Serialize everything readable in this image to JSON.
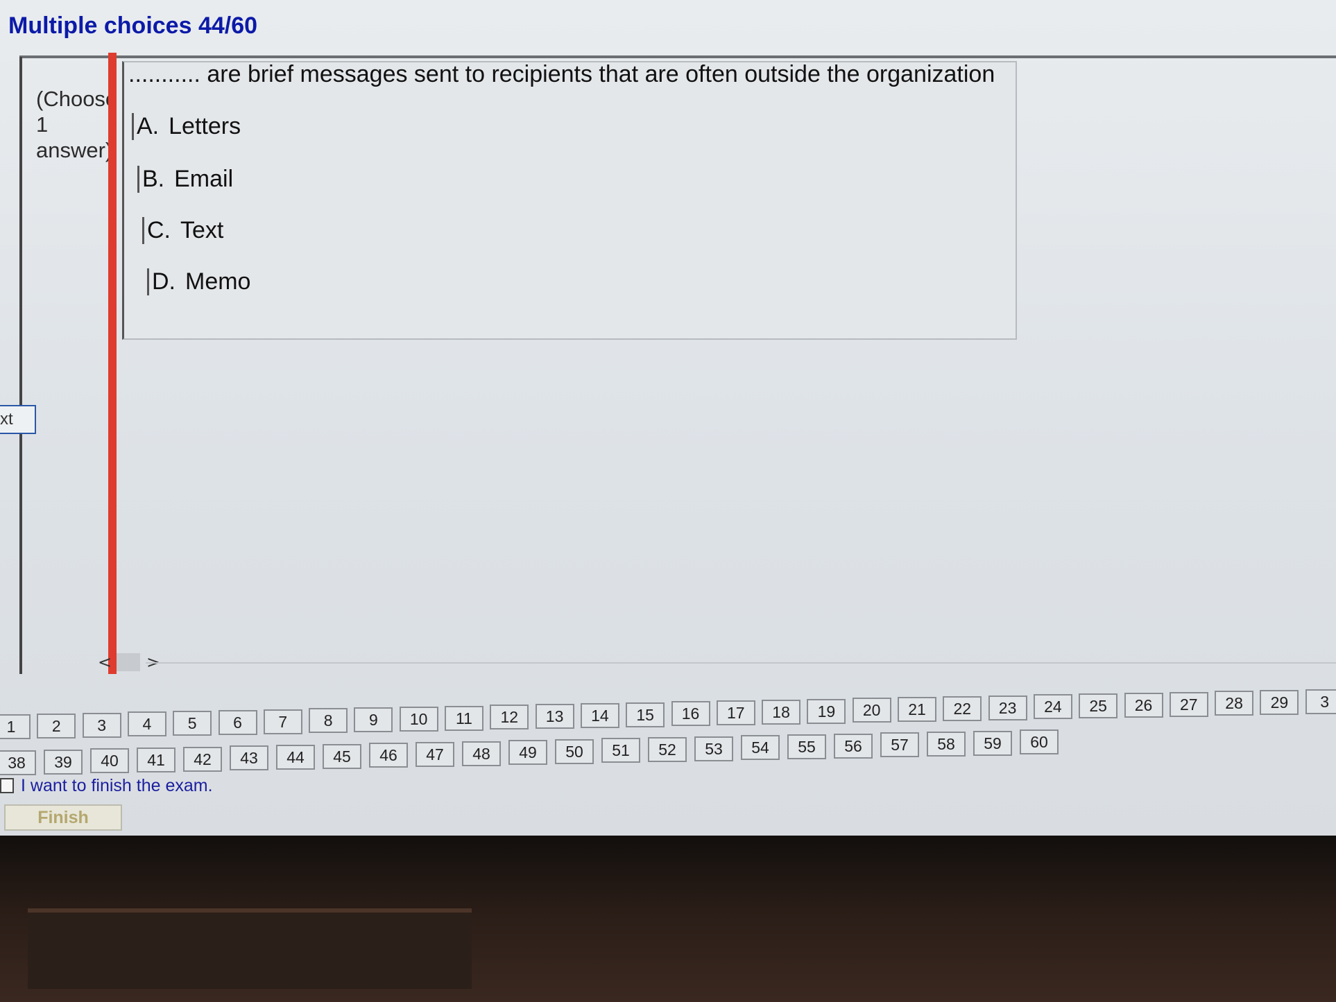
{
  "header": {
    "title": "Multiple choices 44/60"
  },
  "sidebar": {
    "instruction": "(Choose\n1\nanswer)",
    "next_label": "xt"
  },
  "question": {
    "text": "........... are brief messages sent to recipients that are often outside the organization",
    "options": [
      {
        "letter": "A.",
        "text": "Letters"
      },
      {
        "letter": "B.",
        "text": "Email"
      },
      {
        "letter": "C.",
        "text": "Text"
      },
      {
        "letter": "D.",
        "text": "Memo"
      }
    ]
  },
  "scroll": {
    "prev": "<",
    "next": ">"
  },
  "navigation": {
    "row1": [
      "1",
      "2",
      "3",
      "4",
      "5",
      "6",
      "7",
      "8",
      "9",
      "10",
      "11",
      "12",
      "13",
      "14",
      "15",
      "16",
      "17",
      "18",
      "19",
      "20",
      "21",
      "22",
      "23",
      "24",
      "25",
      "26",
      "27",
      "28",
      "29",
      "3"
    ],
    "row2": [
      "38",
      "39",
      "40",
      "41",
      "42",
      "43",
      "44",
      "45",
      "46",
      "47",
      "48",
      "49",
      "50",
      "51",
      "52",
      "53",
      "54",
      "55",
      "56",
      "57",
      "58",
      "59",
      "60"
    ]
  },
  "footer": {
    "finish_checkbox_label": "I want to finish the exam.",
    "finish_button": "Finish"
  }
}
